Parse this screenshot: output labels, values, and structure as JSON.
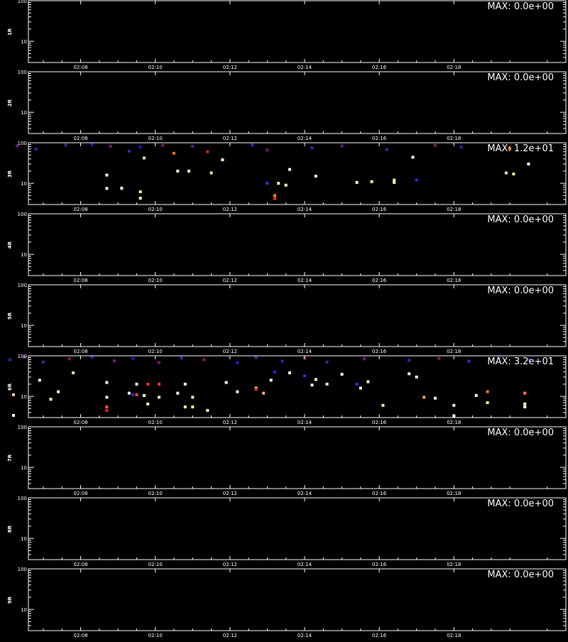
{
  "chart_data": {
    "type": "heatmap",
    "footer": "",
    "panels": [
      {
        "label": "1R",
        "max": "MAX: 0.0e+00",
        "x_ticks": [
          "02:08",
          "02:10",
          "02:12",
          "02:14",
          "02:16",
          "02:18"
        ],
        "y_ticks": [
          "100",
          "10"
        ],
        "ylim": [
          3,
          100
        ],
        "yscale": "log",
        "points": []
      },
      {
        "label": "2R",
        "max": "MAX: 0.0e+00",
        "x_ticks": [
          "02:08",
          "02:10",
          "02:12",
          "02:14",
          "02:16",
          "02:18"
        ],
        "y_ticks": [
          "100",
          "10"
        ],
        "ylim": [
          3,
          100
        ],
        "yscale": "log",
        "points": []
      },
      {
        "label": "3R",
        "max": "MAX: 1.2e+01",
        "x_ticks": [
          "02:08",
          "02:10",
          "02:12",
          "02:14",
          "02:16",
          "02:18"
        ],
        "y_ticks": [
          "100",
          "10"
        ],
        "ylim": [
          3,
          100
        ],
        "yscale": "log",
        "points": [
          {
            "t": 6.3,
            "y": 84,
            "c": "#6a1a9a"
          },
          {
            "t": 6.8,
            "y": 70,
            "c": "#2a2ab0"
          },
          {
            "t": 7.6,
            "y": 88,
            "c": "#5a2090"
          },
          {
            "t": 8.3,
            "y": 90,
            "c": "#2020c0"
          },
          {
            "t": 8.8,
            "y": 82,
            "c": "#7a1a70"
          },
          {
            "t": 9.3,
            "y": 62,
            "c": "#3a2aa0"
          },
          {
            "t": 9.6,
            "y": 78,
            "c": "#1a1ad0"
          },
          {
            "t": 10.2,
            "y": 86,
            "c": "#801a60"
          },
          {
            "t": 10.5,
            "y": 55,
            "c": "#ff7020"
          },
          {
            "t": 11.0,
            "y": 82,
            "c": "#4a2aa0"
          },
          {
            "t": 11.4,
            "y": 60,
            "c": "#c03020"
          },
          {
            "t": 12.6,
            "y": 88,
            "c": "#3030c0"
          },
          {
            "t": 13.0,
            "y": 66,
            "c": "#7a1a70"
          },
          {
            "t": 14.2,
            "y": 75,
            "c": "#2a2ab0"
          },
          {
            "t": 15.0,
            "y": 84,
            "c": "#6a1a8a"
          },
          {
            "t": 16.2,
            "y": 68,
            "c": "#3a2aa0"
          },
          {
            "t": 17.5,
            "y": 86,
            "c": "#8a1a60"
          },
          {
            "t": 18.2,
            "y": 78,
            "c": "#2a2ab0"
          },
          {
            "t": 19.5,
            "y": 72,
            "c": "#ff8030"
          },
          {
            "t": 8.7,
            "y": 16,
            "c": "#ffffee"
          },
          {
            "t": 8.7,
            "y": 7.5,
            "c": "#ffffc0"
          },
          {
            "t": 9.1,
            "y": 7.3,
            "c": "#3030e0"
          },
          {
            "t": 9.1,
            "y": 7.6,
            "c": "#ffffc0"
          },
          {
            "t": 9.6,
            "y": 6.2,
            "c": "#ffff90"
          },
          {
            "t": 9.6,
            "y": 4.3,
            "c": "#ffffb0"
          },
          {
            "t": 9.7,
            "y": 42,
            "c": "#ffe0a0"
          },
          {
            "t": 10.6,
            "y": 20,
            "c": "#ffffd0"
          },
          {
            "t": 10.9,
            "y": 20,
            "c": "#ffffd0"
          },
          {
            "t": 11.5,
            "y": 18,
            "c": "#ffe0a0"
          },
          {
            "t": 11.8,
            "y": 38,
            "c": "#ffffe0"
          },
          {
            "t": 13.0,
            "y": 10,
            "c": "#3030e0"
          },
          {
            "t": 13.3,
            "y": 10,
            "c": "#ffffa0"
          },
          {
            "t": 13.2,
            "y": 5.0,
            "c": "#ff8020"
          },
          {
            "t": 13.2,
            "y": 4.2,
            "c": "#ff3010"
          },
          {
            "t": 13.5,
            "y": 9,
            "c": "#ffffc0"
          },
          {
            "t": 13.6,
            "y": 22,
            "c": "#ffffe0"
          },
          {
            "t": 14.3,
            "y": 15,
            "c": "#ffffe0"
          },
          {
            "t": 15.4,
            "y": 10.5,
            "c": "#ffffb0"
          },
          {
            "t": 15.8,
            "y": 11,
            "c": "#ffffb0"
          },
          {
            "t": 16.4,
            "y": 10.5,
            "c": "#ffffb0"
          },
          {
            "t": 16.4,
            "y": 12,
            "c": "#ffffa0"
          },
          {
            "t": 16.9,
            "y": 44,
            "c": "#ffffe0"
          },
          {
            "t": 17.0,
            "y": 12,
            "c": "#3030e0"
          },
          {
            "t": 19.4,
            "y": 18,
            "c": "#ffe0a0"
          },
          {
            "t": 19.6,
            "y": 17,
            "c": "#ffe0a0"
          },
          {
            "t": 20.0,
            "y": 30,
            "c": "#ffffe0"
          }
        ]
      },
      {
        "label": "4R",
        "max": "MAX: 0.0e+00",
        "x_ticks": [
          "02:08",
          "02:10",
          "02:12",
          "02:14",
          "02:16",
          "02:18"
        ],
        "y_ticks": [
          "100",
          "10"
        ],
        "ylim": [
          3,
          100
        ],
        "yscale": "log",
        "points": []
      },
      {
        "label": "5R",
        "max": "MAX: 0.0e+00",
        "x_ticks": [
          "02:08",
          "02:10",
          "02:12",
          "02:14",
          "02:16",
          "02:18"
        ],
        "y_ticks": [
          "100",
          "10"
        ],
        "ylim": [
          3,
          100
        ],
        "yscale": "log",
        "points": []
      },
      {
        "label": "6R",
        "max": "MAX: 3.2e+01",
        "x_ticks": [
          "02:08",
          "02:10",
          "02:12",
          "02:14",
          "02:16",
          "02:18"
        ],
        "y_ticks": [
          "100",
          "10"
        ],
        "ylim": [
          3,
          100
        ],
        "yscale": "log",
        "points": [
          {
            "t": 6.1,
            "y": 80,
            "c": "#2a2ab0"
          },
          {
            "t": 6.5,
            "y": 92,
            "c": "#6a1a8a"
          },
          {
            "t": 7.0,
            "y": 70,
            "c": "#3a2aa0"
          },
          {
            "t": 7.7,
            "y": 84,
            "c": "#801a60"
          },
          {
            "t": 8.3,
            "y": 92,
            "c": "#2020c0"
          },
          {
            "t": 8.9,
            "y": 75,
            "c": "#6a1a8a"
          },
          {
            "t": 9.4,
            "y": 86,
            "c": "#1a1ad0"
          },
          {
            "t": 10.1,
            "y": 68,
            "c": "#7a1a70"
          },
          {
            "t": 10.7,
            "y": 88,
            "c": "#3030c0"
          },
          {
            "t": 11.3,
            "y": 80,
            "c": "#801a60"
          },
          {
            "t": 12.2,
            "y": 68,
            "c": "#2020e0"
          },
          {
            "t": 12.7,
            "y": 90,
            "c": "#5a2090"
          },
          {
            "t": 13.4,
            "y": 74,
            "c": "#2a2ab0"
          },
          {
            "t": 14.0,
            "y": 88,
            "c": "#7a1a70"
          },
          {
            "t": 14.6,
            "y": 70,
            "c": "#3a2aa0"
          },
          {
            "t": 15.6,
            "y": 84,
            "c": "#6a1a8a"
          },
          {
            "t": 16.8,
            "y": 78,
            "c": "#2a2ab0"
          },
          {
            "t": 17.6,
            "y": 86,
            "c": "#8a1a60"
          },
          {
            "t": 18.4,
            "y": 74,
            "c": "#3030c0"
          },
          {
            "t": 19.2,
            "y": 90,
            "c": "#6a1a8a"
          },
          {
            "t": 20.0,
            "y": 80,
            "c": "#2a2ab0"
          },
          {
            "t": 6.2,
            "y": 11,
            "c": "#ffd0a0"
          },
          {
            "t": 6.2,
            "y": 3.4,
            "c": "#ffffd0"
          },
          {
            "t": 6.9,
            "y": 25,
            "c": "#ffffe0"
          },
          {
            "t": 7.2,
            "y": 8.5,
            "c": "#ffffb0"
          },
          {
            "t": 7.4,
            "y": 13,
            "c": "#ffffc0"
          },
          {
            "t": 7.8,
            "y": 38,
            "c": "#ffe0a0"
          },
          {
            "t": 8.7,
            "y": 9.5,
            "c": "#ffffe0"
          },
          {
            "t": 8.7,
            "y": 5.5,
            "c": "#ff6020"
          },
          {
            "t": 8.7,
            "y": 4.5,
            "c": "#ff2010"
          },
          {
            "t": 8.7,
            "y": 22,
            "c": "#ffffd0"
          },
          {
            "t": 9.3,
            "y": 12,
            "c": "#ffffe0"
          },
          {
            "t": 9.4,
            "y": 11,
            "c": "#3030e0"
          },
          {
            "t": 9.5,
            "y": 11,
            "c": "#ff5020"
          },
          {
            "t": 9.5,
            "y": 20,
            "c": "#ffffd0"
          },
          {
            "t": 9.7,
            "y": 10.5,
            "c": "#ffffb0"
          },
          {
            "t": 9.8,
            "y": 6.5,
            "c": "#ffffb0"
          },
          {
            "t": 9.8,
            "y": 20,
            "c": "#ff3020"
          },
          {
            "t": 10.1,
            "y": 20,
            "c": "#ff4020"
          },
          {
            "t": 10.1,
            "y": 9.5,
            "c": "#ffffd0"
          },
          {
            "t": 10.6,
            "y": 12,
            "c": "#ffffe0"
          },
          {
            "t": 10.8,
            "y": 20,
            "c": "#ffffe0"
          },
          {
            "t": 10.8,
            "y": 5.5,
            "c": "#ffffa0"
          },
          {
            "t": 11.0,
            "y": 5.5,
            "c": "#ffffa0"
          },
          {
            "t": 11.0,
            "y": 9.5,
            "c": "#ffffc0"
          },
          {
            "t": 11.4,
            "y": 4.5,
            "c": "#ffffd0"
          },
          {
            "t": 11.9,
            "y": 22,
            "c": "#ffffe0"
          },
          {
            "t": 12.2,
            "y": 13,
            "c": "#ffffd0"
          },
          {
            "t": 12.7,
            "y": 16,
            "c": "#ffe0a0"
          },
          {
            "t": 12.7,
            "y": 15,
            "c": "#ff3020"
          },
          {
            "t": 12.9,
            "y": 12,
            "c": "#ffb090"
          },
          {
            "t": 13.1,
            "y": 25,
            "c": "#ffffe0"
          },
          {
            "t": 13.2,
            "y": 40,
            "c": "#2020e0"
          },
          {
            "t": 13.6,
            "y": 38,
            "c": "#ffffe0"
          },
          {
            "t": 14.0,
            "y": 32,
            "c": "#3030e0"
          },
          {
            "t": 14.2,
            "y": 19,
            "c": "#ffffe0"
          },
          {
            "t": 14.3,
            "y": 26,
            "c": "#ffffd0"
          },
          {
            "t": 14.6,
            "y": 20,
            "c": "#ffffd0"
          },
          {
            "t": 15.0,
            "y": 35,
            "c": "#ffffe0"
          },
          {
            "t": 15.4,
            "y": 20,
            "c": "#3030e0"
          },
          {
            "t": 15.5,
            "y": 16,
            "c": "#ffffe0"
          },
          {
            "t": 15.7,
            "y": 23,
            "c": "#ffffd0"
          },
          {
            "t": 16.1,
            "y": 6,
            "c": "#ffffb0"
          },
          {
            "t": 16.8,
            "y": 36,
            "c": "#ffffe0"
          },
          {
            "t": 17.0,
            "y": 30,
            "c": "#ffffd0"
          },
          {
            "t": 17.2,
            "y": 9.5,
            "c": "#ffa060"
          },
          {
            "t": 17.5,
            "y": 9,
            "c": "#ffffc0"
          },
          {
            "t": 18.0,
            "y": 6,
            "c": "#ffffd0"
          },
          {
            "t": 18.0,
            "y": 3.3,
            "c": "#ffffe0"
          },
          {
            "t": 18.6,
            "y": 10.5,
            "c": "#ffffd0"
          },
          {
            "t": 18.9,
            "y": 13,
            "c": "#ff8030"
          },
          {
            "t": 18.9,
            "y": 7,
            "c": "#ffff90"
          },
          {
            "t": 19.9,
            "y": 12,
            "c": "#ff8030"
          },
          {
            "t": 19.9,
            "y": 5.5,
            "c": "#ffffe0"
          },
          {
            "t": 19.9,
            "y": 6.5,
            "c": "#ffffc0"
          }
        ]
      },
      {
        "label": "7R",
        "max": "MAX: 0.0e+00",
        "x_ticks": [
          "02:08",
          "02:10",
          "02:12",
          "02:14",
          "02:16",
          "02:18"
        ],
        "y_ticks": [
          "100",
          "10"
        ],
        "ylim": [
          3,
          100
        ],
        "yscale": "log",
        "points": []
      },
      {
        "label": "8R",
        "max": "MAX: 0.0e+00",
        "x_ticks": [
          "02:08",
          "02:10",
          "02:12",
          "02:14",
          "02:16",
          "02:18"
        ],
        "y_ticks": [
          "100",
          "10"
        ],
        "ylim": [
          3,
          100
        ],
        "yscale": "log",
        "points": []
      },
      {
        "label": "9R",
        "max": "MAX: 0.0e+00",
        "x_ticks": [
          "02:08",
          "02:10",
          "02:12",
          "02:14",
          "02:16",
          "02:18"
        ],
        "y_ticks": [
          "100",
          "10"
        ],
        "ylim": [
          3,
          100
        ],
        "yscale": "log",
        "points": []
      }
    ]
  }
}
